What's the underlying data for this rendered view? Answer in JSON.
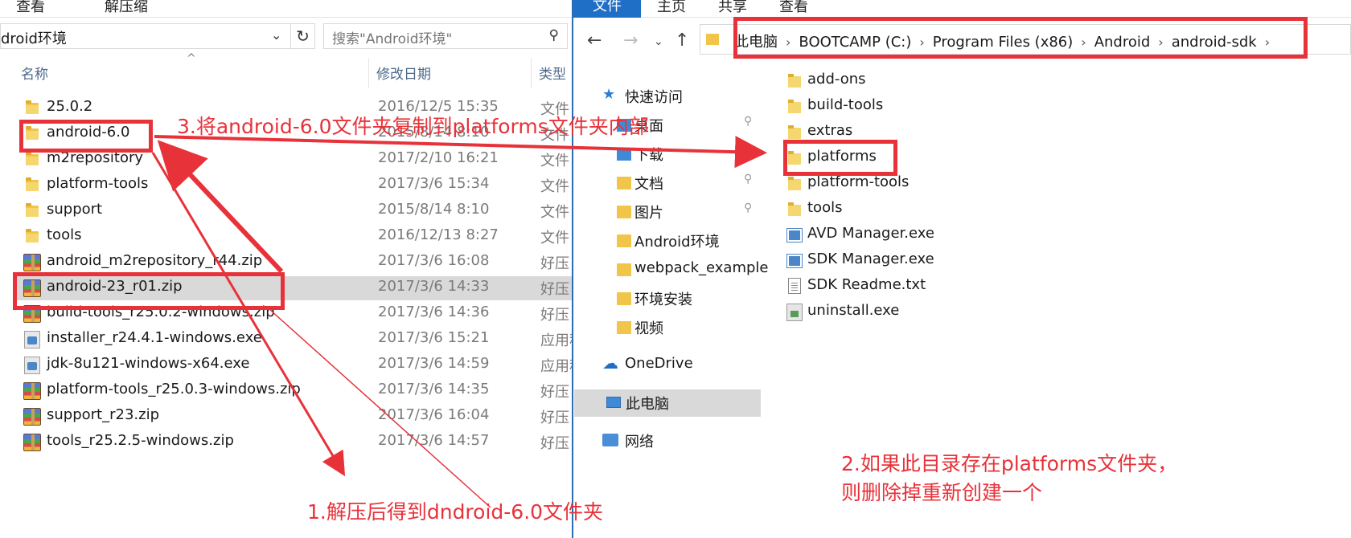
{
  "left": {
    "ribbon_tabs": [
      "查看",
      "解压缩"
    ],
    "address_text": "droid环境",
    "search_placeholder": "搜索\"Android环境\"",
    "columns": {
      "name": "名称",
      "date": "修改日期",
      "type": "类型"
    },
    "files": [
      {
        "name": "25.0.2",
        "date": "2016/12/5 15:35",
        "type": "文件",
        "icon": "folder-icon"
      },
      {
        "name": "android-6.0",
        "date": "2015/8/14 8:10",
        "type": "文件",
        "icon": "folder-icon"
      },
      {
        "name": "m2repository",
        "date": "2017/2/10 16:21",
        "type": "文件",
        "icon": "folder-icon"
      },
      {
        "name": "platform-tools",
        "date": "2017/3/6 15:34",
        "type": "文件",
        "icon": "folder-icon"
      },
      {
        "name": "support",
        "date": "2015/8/14 8:10",
        "type": "文件",
        "icon": "folder-icon"
      },
      {
        "name": "tools",
        "date": "2016/12/13 8:27",
        "type": "文件",
        "icon": "folder-icon"
      },
      {
        "name": "android_m2repository_r44.zip",
        "date": "2017/3/6 16:08",
        "type": "好压",
        "icon": "zip-icon"
      },
      {
        "name": "android-23_r01.zip",
        "date": "2017/3/6 14:33",
        "type": "好压",
        "icon": "zip-icon",
        "selected": true
      },
      {
        "name": "build-tools_r25.0.2-windows.zip",
        "date": "2017/3/6 14:36",
        "type": "好压",
        "icon": "zip-icon"
      },
      {
        "name": "installer_r24.4.1-windows.exe",
        "date": "2017/3/6 15:21",
        "type": "应用程",
        "icon": "installer-icon"
      },
      {
        "name": "jdk-8u121-windows-x64.exe",
        "date": "2017/3/6 14:59",
        "type": "应用程",
        "icon": "installer-icon"
      },
      {
        "name": "platform-tools_r25.0.3-windows.zip",
        "date": "2017/3/6 14:35",
        "type": "好压",
        "icon": "zip-icon"
      },
      {
        "name": "support_r23.zip",
        "date": "2017/3/6 16:04",
        "type": "好压",
        "icon": "zip-icon"
      },
      {
        "name": "tools_r25.2.5-windows.zip",
        "date": "2017/3/6 14:57",
        "type": "好压",
        "icon": "zip-icon"
      }
    ]
  },
  "right": {
    "ribbon_tabs": [
      "文件",
      "主页",
      "共享",
      "查看"
    ],
    "breadcrumbs": [
      "此电脑",
      "BOOTCAMP (C:)",
      "Program Files (x86)",
      "Android",
      "android-sdk"
    ],
    "nav": {
      "quick_access": "快速访问",
      "pinned": [
        "桌面",
        "下载",
        "文档",
        "图片"
      ],
      "folders": [
        "Android环境",
        "webpack_example",
        "环境安装",
        "视频"
      ],
      "onedrive": "OneDrive",
      "this_pc": "此电脑",
      "network": "网络"
    },
    "files": [
      {
        "name": "add-ons",
        "icon": "folder-icon"
      },
      {
        "name": "build-tools",
        "icon": "folder-icon"
      },
      {
        "name": "extras",
        "icon": "folder-icon"
      },
      {
        "name": "platforms",
        "icon": "folder-icon"
      },
      {
        "name": "platform-tools",
        "icon": "folder-icon"
      },
      {
        "name": "tools",
        "icon": "folder-icon"
      },
      {
        "name": "AVD Manager.exe",
        "icon": "app-icon"
      },
      {
        "name": "SDK Manager.exe",
        "icon": "app-icon"
      },
      {
        "name": "SDK Readme.txt",
        "icon": "text-file-icon"
      },
      {
        "name": "uninstall.exe",
        "icon": "uninstaller-icon"
      }
    ]
  },
  "annotations": {
    "step1": "1.解压后得到dndroid-6.0文件夹",
    "step2_line1": "2.如果此目录存在platforms文件夹，",
    "step2_line2": "则删除掉重新创建一个",
    "step3": "3.将android-6.0文件夹复制到platforms文件夹内部",
    "color": "#e8323a"
  },
  "colors": {
    "accent": "#1f6fc7",
    "selection": "#d9d9d9",
    "header_text": "#4d6a8a"
  }
}
